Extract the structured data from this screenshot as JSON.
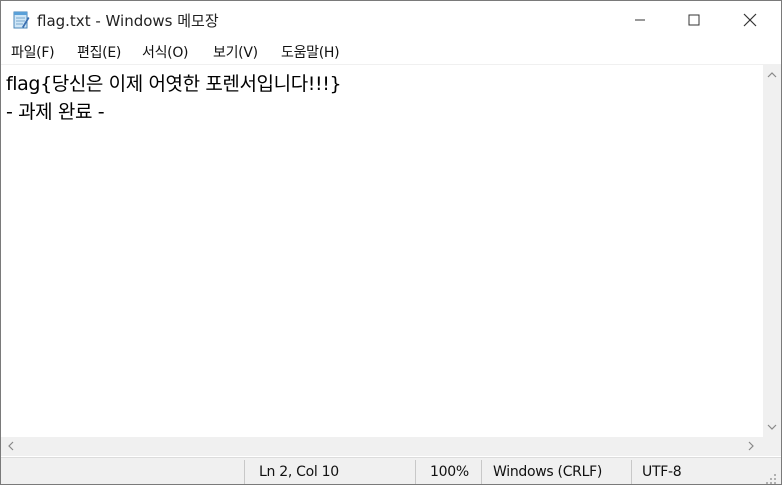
{
  "window": {
    "title": "flag.txt - Windows 메모장",
    "icon": "notepad-icon",
    "controls": [
      "minimize-icon",
      "maximize-icon",
      "close-icon"
    ]
  },
  "menu": {
    "items": [
      {
        "label": "파일(F)"
      },
      {
        "label": "편집(E)"
      },
      {
        "label": "서식(O)"
      },
      {
        "label": "보기(V)"
      },
      {
        "label": "도움말(H)"
      }
    ]
  },
  "document": {
    "lines": [
      "flag{당신은 이제 어엿한 포렌서입니다!!!}",
      "- 과제 완료 -"
    ]
  },
  "status": {
    "position": "Ln 2, Col 10",
    "zoom": "100%",
    "line_ending": "Windows (CRLF)",
    "encoding": "UTF-8"
  },
  "colors": {
    "chrome_bg": "#f0f0f0",
    "text": "#000000"
  }
}
